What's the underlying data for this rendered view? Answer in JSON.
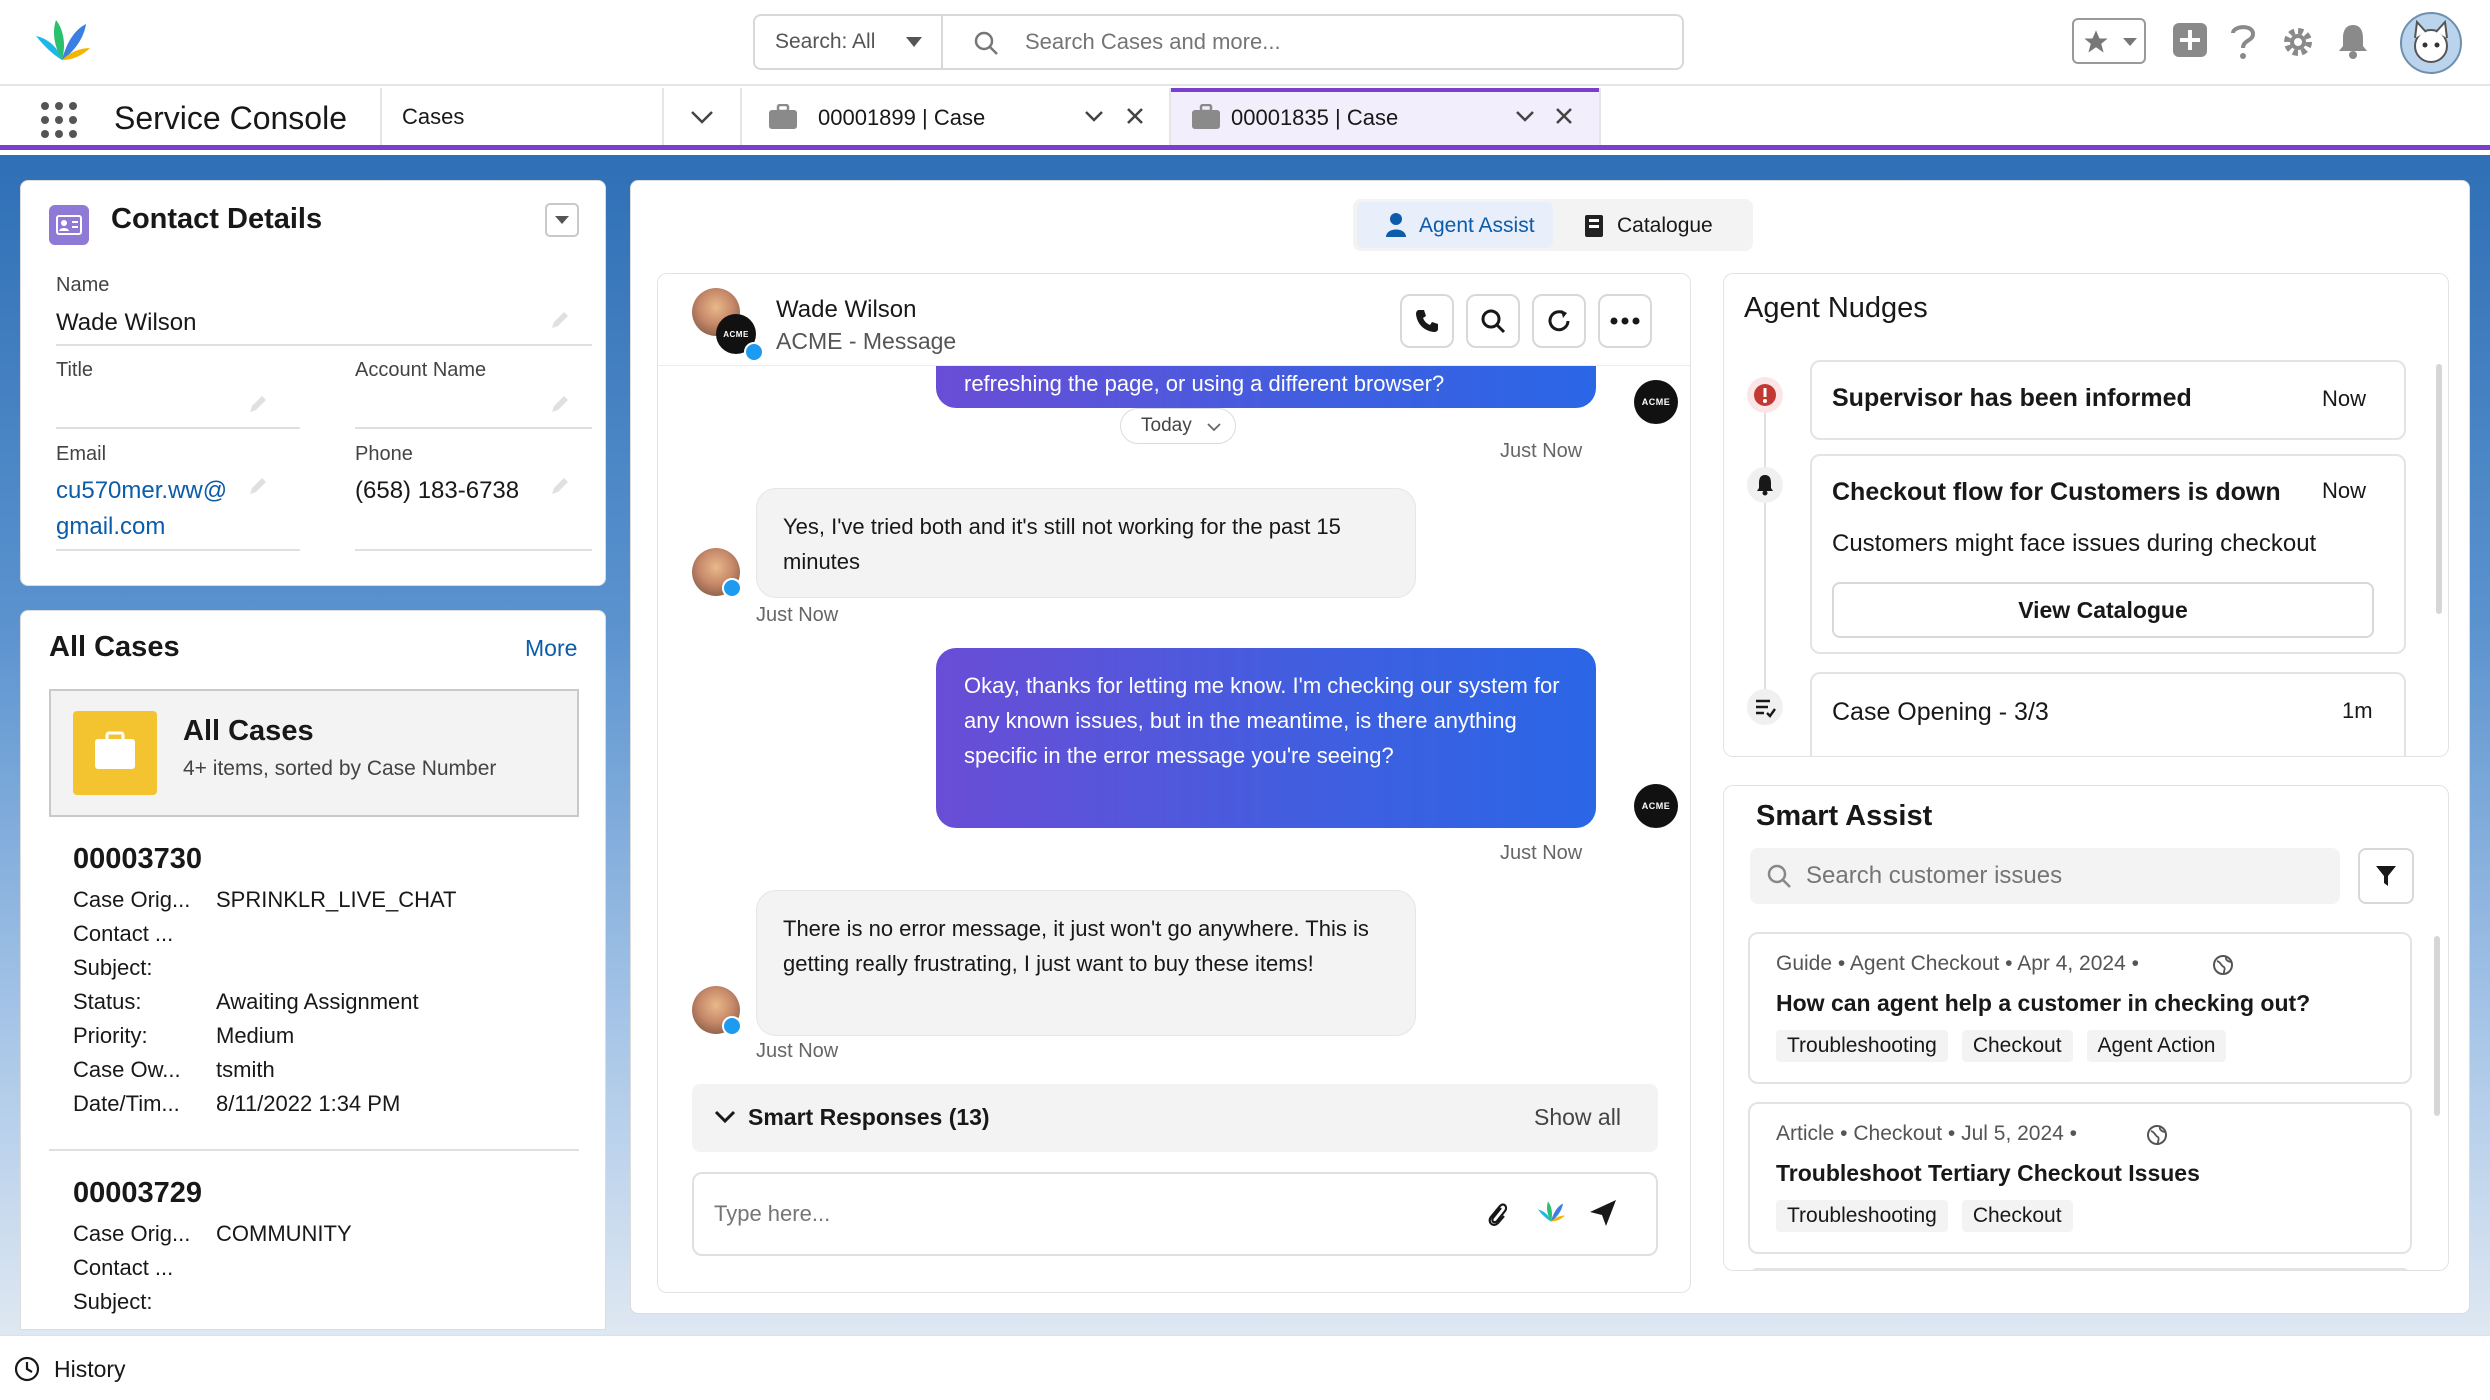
{
  "header": {
    "search_scope": "Search: All",
    "search_placeholder": "Search Cases and more..."
  },
  "nav": {
    "app_name": "Service Console",
    "object_tab": "Cases",
    "tabs": [
      {
        "label": "00001899 | Case",
        "active": false
      },
      {
        "label": "00001835 | Case",
        "active": true
      }
    ]
  },
  "contact": {
    "title": "Contact Details",
    "name_label": "Name",
    "name": "Wade Wilson",
    "title_label": "Title",
    "title_value": "",
    "account_label": "Account Name",
    "account_value": "",
    "email_label": "Email",
    "email_line1": "cu570mer.ww@",
    "email_line2": "gmail.com",
    "phone_label": "Phone",
    "phone": "(658) 183-6738"
  },
  "cases": {
    "title": "All Cases",
    "more": "More",
    "banner_title": "All Cases",
    "banner_sub": "4+ items, sorted by Case Number",
    "items": [
      {
        "number": "00003730",
        "fields": [
          {
            "k": "Case Orig...",
            "v": "SPRINKLR_LIVE_CHAT"
          },
          {
            "k": "Contact ...",
            "v": ""
          },
          {
            "k": "Subject:",
            "v": ""
          },
          {
            "k": "Status:",
            "v": "Awaiting Assignment"
          },
          {
            "k": "Priority:",
            "v": "Medium"
          },
          {
            "k": "Case Ow...",
            "v": "tsmith"
          },
          {
            "k": "Date/Tim...",
            "v": "8/11/2022 1:34 PM"
          }
        ]
      },
      {
        "number": "00003729",
        "fields": [
          {
            "k": "Case Orig...",
            "v": "COMMUNITY"
          },
          {
            "k": "Contact ...",
            "v": ""
          },
          {
            "k": "Subject:",
            "v": ""
          }
        ]
      }
    ]
  },
  "workspace": {
    "tab_agent_assist": "Agent Assist",
    "tab_catalogue": "Catalogue"
  },
  "chat": {
    "contact_name": "Wade Wilson",
    "channel": "ACME - Message",
    "acme_badge": "ACME",
    "today_pill": "Today",
    "messages": [
      {
        "dir": "out",
        "text": "refreshing the page, or using a different browser?",
        "time": "Just Now"
      },
      {
        "dir": "in",
        "text": "Yes, I've tried both and it's still not working for the past 15 minutes",
        "time": "Just Now"
      },
      {
        "dir": "out",
        "text": "Okay, thanks for letting me know.  I'm checking our system for any known issues, but in the meantime, is there anything specific in the error message you're seeing?",
        "time": "Just Now"
      },
      {
        "dir": "in",
        "text": "There is no error message, it just won't go anywhere. This is getting really frustrating, I just want to buy these items!",
        "time": "Just Now"
      }
    ],
    "smart_responses": "Smart Responses (13)",
    "show_all": "Show all",
    "input_placeholder": "Type here..."
  },
  "nudges": {
    "title": "Agent Nudges",
    "items": [
      {
        "title": "Supervisor has been informed",
        "time": "Now"
      },
      {
        "title": "Checkout flow for Customers is down",
        "time": "Now",
        "body": "Customers might face issues during checkout",
        "button": "View Catalogue"
      },
      {
        "title": "Case Opening - 3/3",
        "time": "1m"
      }
    ]
  },
  "smart_assist": {
    "title": "Smart Assist",
    "search_placeholder": "Search customer issues",
    "articles": [
      {
        "meta": "Guide  •  Agent Checkout  •  Apr 4, 2024  •",
        "title": "How can agent help a customer in checking out?",
        "tags": [
          "Troubleshooting",
          "Checkout",
          "Agent Action"
        ]
      },
      {
        "meta": "Article  •  Checkout  •  Jul 5, 2024  •",
        "title": "Troubleshoot Tertiary Checkout Issues",
        "tags": [
          "Troubleshooting",
          "Checkout"
        ]
      }
    ]
  },
  "footer": {
    "history": "History"
  },
  "colors": {
    "accent_purple": "#7b3fd0",
    "link_blue": "#0b5cab",
    "bubble_gradient_start": "#6a4dd6",
    "bubble_gradient_end": "#2a66e6",
    "alert_red": "#c23934",
    "folder_yellow": "#f4c430"
  }
}
